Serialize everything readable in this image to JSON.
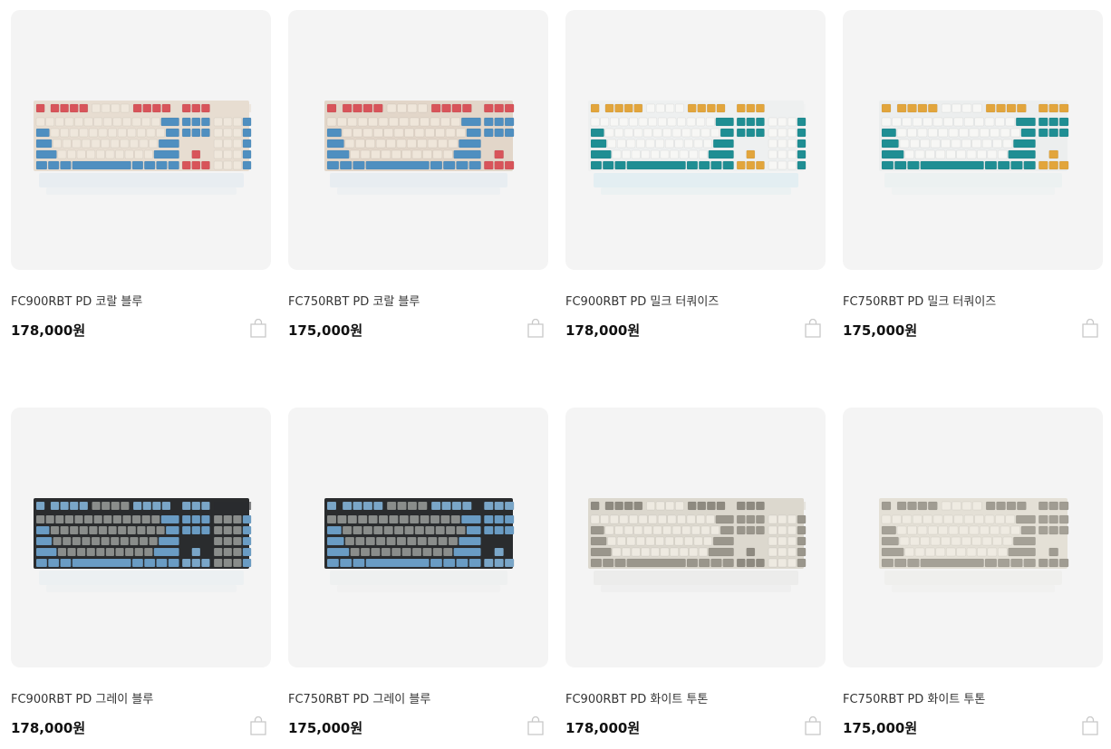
{
  "products": [
    {
      "name": "FC900RBT PD 코랄 블루",
      "price": "178,000원",
      "layout": "full",
      "colors": {
        "case": "#e7ddd1",
        "base": "#efe7dc",
        "accent": "#d8545a",
        "accent2": "#4f8fc0",
        "legend": "#8a7f74",
        "reflect": "#dfe7ef"
      }
    },
    {
      "name": "FC750RBT PD 코랄 블루",
      "price": "175,000원",
      "layout": "tkl",
      "colors": {
        "case": "#e2d6c9",
        "base": "#efe6da",
        "accent": "#d8545a",
        "accent2": "#4f8fc0",
        "legend": "#8a7f74",
        "reflect": "#dfe7ef"
      }
    },
    {
      "name": "FC900RBT PD 밀크 터쿼이즈",
      "price": "178,000원",
      "layout": "full",
      "colors": {
        "case": "#eef0f0",
        "base": "#f7f7f5",
        "accent": "#e2a53c",
        "accent2": "#1f8e93",
        "legend": "#7d7d7d",
        "reflect": "#d6eaf0"
      }
    },
    {
      "name": "FC750RBT PD 밀크 터쿼이즈",
      "price": "175,000원",
      "layout": "tkl",
      "colors": {
        "case": "#eceeee",
        "base": "#f7f7f5",
        "accent": "#e2a53c",
        "accent2": "#1f8e93",
        "legend": "#7d7d7d",
        "reflect": "#e6eeee"
      }
    },
    {
      "name": "FC900RBT PD 그레이 블루",
      "price": "178,000원",
      "layout": "full",
      "colors": {
        "case": "#2a2c2e",
        "base": "#8a8d8b",
        "accent": "#7aa6c8",
        "accent2": "#6a9cc4",
        "legend": "#2a2c2e",
        "reflect": "#e6ecf0"
      }
    },
    {
      "name": "FC750RBT PD 그레이 블루",
      "price": "175,000원",
      "layout": "tkl",
      "colors": {
        "case": "#2a2c2e",
        "base": "#8a8d8b",
        "accent": "#7aa6c8",
        "accent2": "#6a9cc4",
        "legend": "#2a2c2e",
        "reflect": "#eaecec"
      }
    },
    {
      "name": "FC900RBT PD 화이트 투톤",
      "price": "178,000원",
      "layout": "full",
      "colors": {
        "case": "#dcd8ce",
        "base": "#eeeae1",
        "accent": "#8e8a80",
        "accent2": "#9a968c",
        "legend": "#555",
        "reflect": "#e6e6e3"
      }
    },
    {
      "name": "FC750RBT PD 화이트 투톤",
      "price": "175,000원",
      "layout": "tkl",
      "colors": {
        "case": "#e4e0d6",
        "base": "#efebe2",
        "accent": "#a09c92",
        "accent2": "#a5a197",
        "legend": "#555",
        "reflect": "#ebebe8"
      }
    }
  ]
}
